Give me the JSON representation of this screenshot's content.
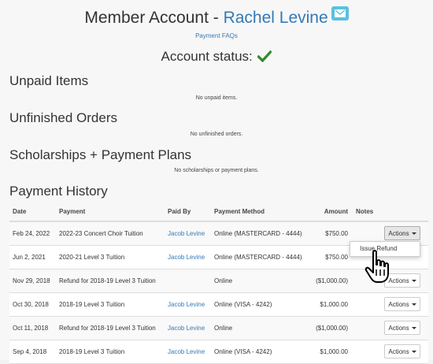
{
  "header": {
    "title_prefix": "Member Account - ",
    "member_name": "Rachel Levine",
    "faq_link": "Payment FAQs",
    "account_status": "Account status:"
  },
  "sections": {
    "unpaid": {
      "title": "Unpaid Items",
      "empty": "No unpaid items."
    },
    "unfinished": {
      "title": "Unfinished Orders",
      "empty": "No unfinished orders."
    },
    "scholarships": {
      "title": "Scholarships + Payment Plans",
      "empty": "No scholarships or payment plans."
    },
    "history": {
      "title": "Payment History"
    }
  },
  "table": {
    "headers": {
      "date": "Date",
      "payment": "Payment",
      "paid_by": "Paid By",
      "method": "Payment Method",
      "amount": "Amount",
      "notes": "Notes"
    },
    "rows": [
      {
        "date": "Feb 24, 2022",
        "payment": "2022-23 Concert Choir Tuition",
        "paid_by": "Jacob Levine",
        "method": "Online (MASTERCARD - 4444)",
        "amount": "$750.00",
        "notes": "",
        "action": "Actions"
      },
      {
        "date": "Jun 2, 2021",
        "payment": "2020-21 Level 3 Tuition",
        "paid_by": "Jacob Levine",
        "method": "Online (MASTERCARD - 4444)",
        "amount": "$750.00",
        "notes": "",
        "action": ""
      },
      {
        "date": "Nov 29, 2018",
        "payment": "Refund for 2018-19 Level 3 Tuition",
        "paid_by": "",
        "method": "Online",
        "amount": "($1,000.00)",
        "notes": "",
        "action": "Actions"
      },
      {
        "date": "Oct 30, 2018",
        "payment": "2018-19 Level 3 Tuition",
        "paid_by": "Jacob Levine",
        "method": "Online (VISA - 4242)",
        "amount": "$1,000.00",
        "notes": "",
        "action": "Actions"
      },
      {
        "date": "Oct 11, 2018",
        "payment": "Refund for 2018-19 Level 3 Tuition",
        "paid_by": "Jacob Levine",
        "method": "Online",
        "amount": "($1,000.00)",
        "notes": "",
        "action": "Actions"
      },
      {
        "date": "Sep 4, 2018",
        "payment": "2018-19 Level 3 Tuition",
        "paid_by": "Jacob Levine",
        "method": "Online (VISA - 4242)",
        "amount": "$1,000.00",
        "notes": "",
        "action": "Actions"
      }
    ]
  },
  "dropdown": {
    "issue_refund": "Issue Refund"
  },
  "icons": {
    "mail": "envelope-icon",
    "status": "check-icon",
    "cursor": "hand-pointer-icon"
  },
  "colors": {
    "link": "#337ab7",
    "check": "#2e8b2e",
    "mail_bg": "#5bc0de"
  }
}
